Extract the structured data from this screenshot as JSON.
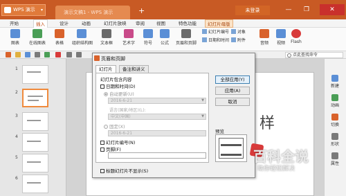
{
  "titlebar": {
    "app_button": "WPS 演示",
    "doc_tab": "演示文稿1 - WPS 演示",
    "new_tab": "+",
    "login": "未登录",
    "min": "—",
    "restore": "❐",
    "close": "✕"
  },
  "ribbon": {
    "tabs": [
      "开始",
      "插入",
      "设计",
      "动画",
      "幻灯片放映",
      "审阅",
      "视图",
      "特色功能",
      "幻灯片母版"
    ],
    "active_tab": "插入",
    "tools": [
      {
        "label": "图表",
        "icon": "chart-icon",
        "color": "#5b8fd6"
      },
      {
        "label": "在线图表",
        "icon": "online-chart-icon",
        "color": "#4a9e56"
      },
      {
        "label": "表格",
        "icon": "table-icon",
        "color": "#d9622b"
      },
      {
        "label": "组织结构图",
        "icon": "org-chart-icon",
        "color": "#5b8fd6"
      },
      {
        "label": "文本框",
        "icon": "textbox-icon",
        "color": "#6b6b6b"
      },
      {
        "label": "艺术字",
        "icon": "wordart-icon",
        "color": "#c94b8a"
      },
      {
        "label": "符号",
        "icon": "symbol-icon",
        "color": "#5b8fd6"
      },
      {
        "label": "公式",
        "icon": "formula-icon",
        "color": "#5b8fd6"
      },
      {
        "label": "页眉和页脚",
        "icon": "header-footer-icon",
        "color": "#6b6b6b"
      }
    ],
    "small_tools": [
      "幻灯片编号",
      "日期和时间",
      "对象",
      "附件"
    ],
    "media_tools": [
      {
        "label": "音频",
        "icon": "audio-icon",
        "color": "#d9622b"
      },
      {
        "label": "视频",
        "icon": "video-icon",
        "color": "#5b8fd6"
      },
      {
        "label": "Flash",
        "icon": "flash-icon",
        "color": "#d83a3a"
      }
    ]
  },
  "quickbar": {
    "search_placeholder": "点此查找命令"
  },
  "thumbnails": [
    {
      "num": "1"
    },
    {
      "num": "2"
    },
    {
      "num": "3"
    },
    {
      "num": "4"
    },
    {
      "num": "5"
    },
    {
      "num": "6"
    }
  ],
  "slide": {
    "text": "样"
  },
  "right_pane": [
    "新建",
    "动画",
    "切换",
    "形状",
    "属性"
  ],
  "dialog": {
    "title": "页眉和页脚",
    "tabs": [
      "幻灯片",
      "备注和讲义"
    ],
    "group_label": "幻灯片包含内容",
    "date_time_label": "日期和时间(D)",
    "auto_update_label": "自动更新(U)",
    "auto_date": "2016-6-21",
    "language_label": "语言(国家/地区)(L):",
    "language_value": "中文(中国)",
    "fixed_label": "固定(X)",
    "fixed_value": "2016-6-21",
    "slide_number_label": "幻灯片编号(N)",
    "footer_label": "页脚(F)",
    "title_slide_label": "标题幻灯片不显示(S)",
    "buttons": {
      "apply_all": "全部应用(Y)",
      "apply": "应用(A)",
      "cancel": "取消"
    },
    "preview_label": "预览"
  },
  "watermark": {
    "title": "百科全说",
    "subtitle": "助你轻松解决"
  }
}
